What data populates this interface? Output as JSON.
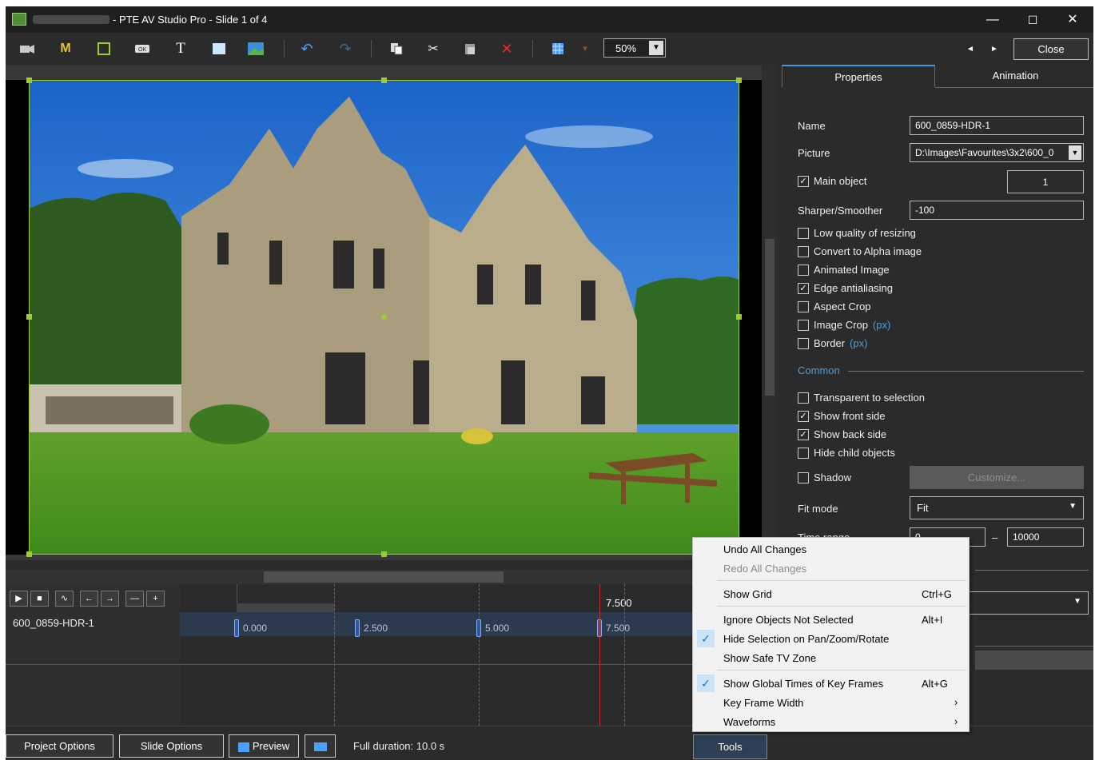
{
  "window": {
    "title": "- PTE AV Studio Pro - Slide 1 of 4",
    "controls": {
      "minimize": "—",
      "maximize": "☐",
      "close": "✕"
    }
  },
  "toolbar": {
    "items": [
      "camera-icon",
      "mask-icon",
      "frame-icon",
      "button-icon",
      "text-icon",
      "rectangle-icon",
      "image-icon",
      "undo-icon",
      "redo-icon",
      "copy-icon",
      "cut-icon",
      "paste-icon",
      "delete-icon",
      "grid-icon",
      "dropdown-icon"
    ],
    "m_label": "M",
    "t_label": "T",
    "zoom": "50%",
    "close_label": "Close",
    "nav_prev": "◄",
    "nav_next": "►"
  },
  "panel": {
    "tabs": [
      "Properties",
      "Animation"
    ],
    "name_label": "Name",
    "name_value": "600_0859-HDR-1",
    "picture_label": "Picture",
    "picture_value": "D:\\Images\\Favourites\\3x2\\600_0",
    "main_object_label": "Main object",
    "main_object_value": "1",
    "sharper_label": "Sharper/Smoother",
    "sharper_value": "-100",
    "checks": [
      {
        "label": "Low quality of resizing",
        "checked": false
      },
      {
        "label": "Convert to Alpha image",
        "checked": false
      },
      {
        "label": "Animated Image",
        "checked": false
      },
      {
        "label": "Edge antialiasing",
        "checked": true
      },
      {
        "label": "Aspect Crop",
        "checked": false
      },
      {
        "label": "Image Crop",
        "checked": false,
        "suffix": "(px)"
      },
      {
        "label": "Border",
        "checked": false,
        "suffix": "(px)"
      }
    ],
    "common_label": "Common",
    "common_checks": [
      {
        "label": "Transparent to selection",
        "checked": false
      },
      {
        "label": "Show front side",
        "checked": true
      },
      {
        "label": "Show back side",
        "checked": true
      },
      {
        "label": "Hide child objects",
        "checked": false
      }
    ],
    "shadow_label": "Shadow",
    "customize_label": "Customize...",
    "fit_mode_label": "Fit mode",
    "fit_mode_value": "Fit",
    "time_range_label": "Time range",
    "time_from": "0",
    "time_dash": "–",
    "time_to": "10000"
  },
  "timeline": {
    "object_name": "600_0859-HDR-1",
    "ruler_label": "7.500",
    "keyframes": [
      "0.000",
      "2.500",
      "5.000",
      "7.500"
    ],
    "controls": [
      "▶",
      "■",
      "∿",
      "←",
      "→",
      "—",
      "+"
    ]
  },
  "bottom": {
    "project_options": "Project Options",
    "slide_options": "Slide Options",
    "preview": "Preview",
    "duration": "Full duration: 10.0 s",
    "tools": "Tools"
  },
  "menu": {
    "items": [
      {
        "label": "Undo All Changes",
        "shortcut": "",
        "checked": false,
        "disabled": false,
        "arrow": ""
      },
      {
        "label": "Redo All Changes",
        "shortcut": "",
        "checked": false,
        "disabled": true,
        "arrow": ""
      },
      {
        "label": "Show Grid",
        "shortcut": "Ctrl+G",
        "checked": false,
        "disabled": false,
        "arrow": ""
      },
      {
        "label": "Ignore Objects Not Selected",
        "shortcut": "Alt+I",
        "checked": false,
        "disabled": false,
        "arrow": ""
      },
      {
        "label": "Hide Selection on Pan/Zoom/Rotate",
        "shortcut": "",
        "checked": true,
        "disabled": false,
        "arrow": ""
      },
      {
        "label": "Show Safe TV Zone",
        "shortcut": "",
        "checked": false,
        "disabled": false,
        "arrow": ""
      },
      {
        "label": "Show Global Times of Key Frames",
        "shortcut": "Alt+G",
        "checked": true,
        "disabled": false,
        "arrow": ""
      },
      {
        "label": "Key Frame Width",
        "shortcut": "",
        "checked": false,
        "disabled": false,
        "arrow": "›"
      },
      {
        "label": "Waveforms",
        "shortcut": "",
        "checked": false,
        "disabled": false,
        "arrow": "›"
      }
    ]
  }
}
